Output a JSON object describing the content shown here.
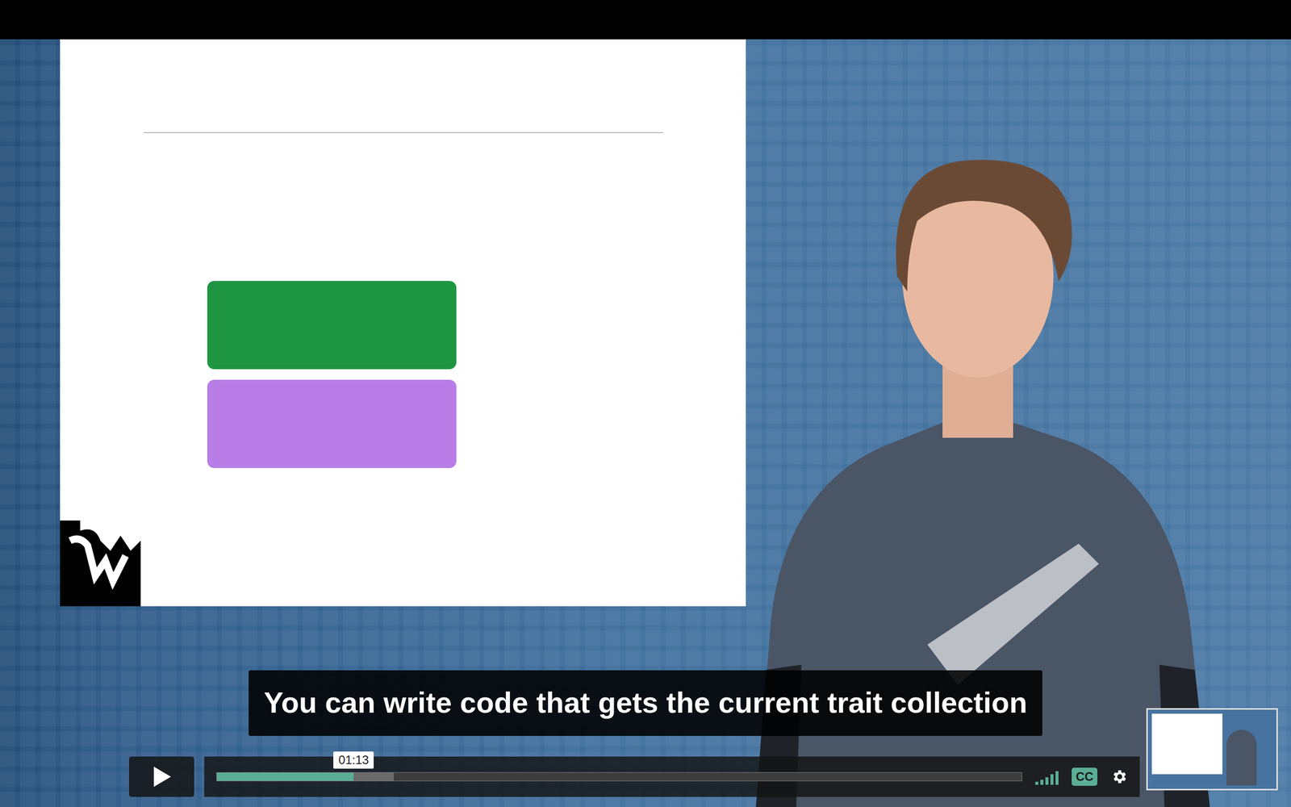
{
  "player": {
    "caption": "You can write code that gets the current trait collection",
    "captions_on": true,
    "paused": true
  },
  "progress": {
    "played": 0.17,
    "buffered": 0.22,
    "tooltip": "01:13"
  },
  "volume": {
    "level": 1
  },
  "cc": {
    "label": "CC",
    "selected": true
  }
}
